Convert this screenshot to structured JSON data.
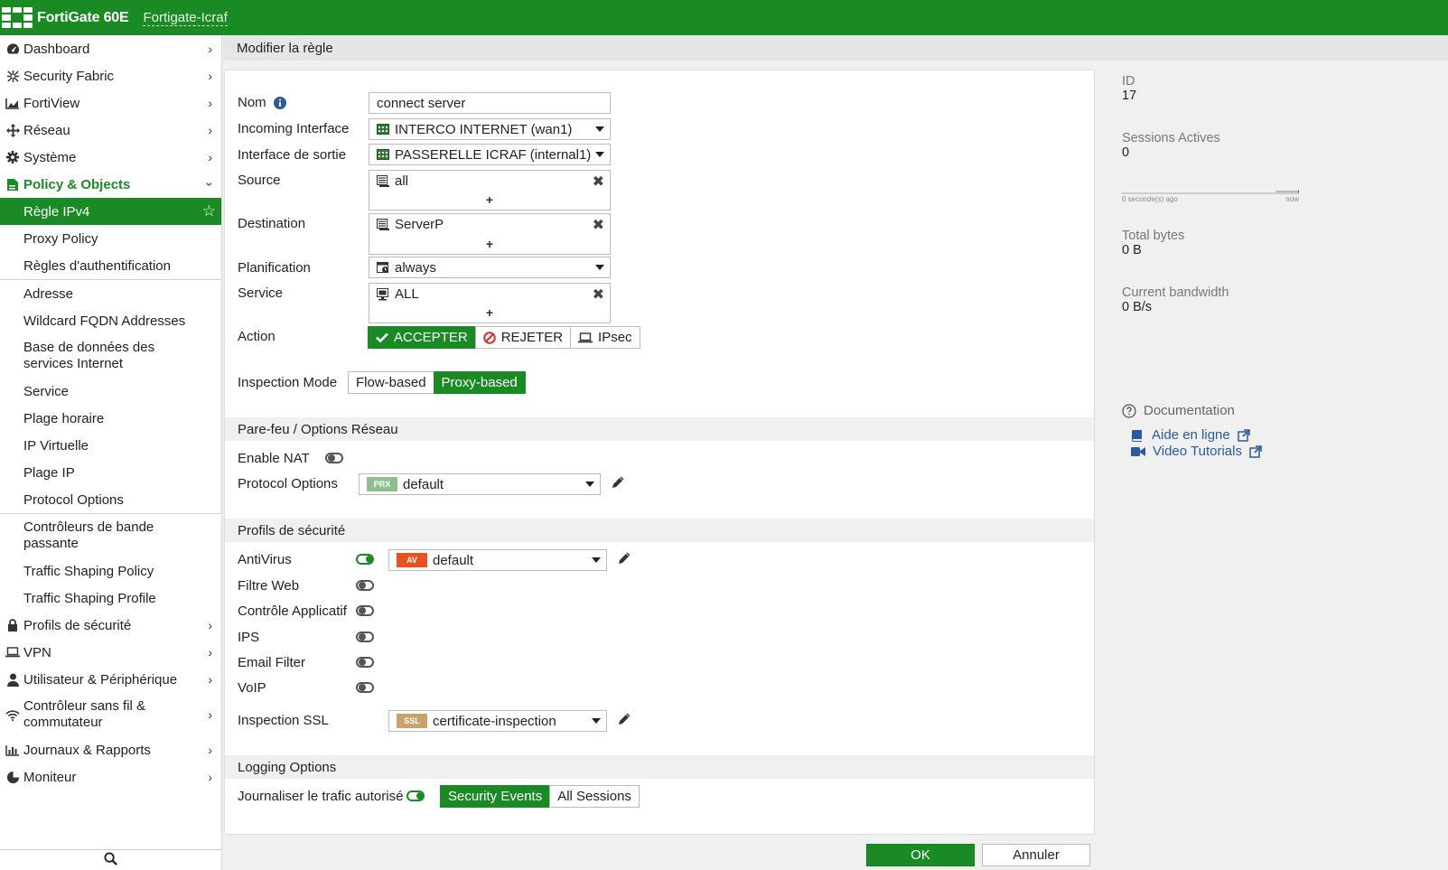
{
  "header": {
    "brand": "FortiGate 60E",
    "hostname": "Fortigate-Icraf"
  },
  "sidebar": {
    "items": [
      {
        "label": "Dashboard",
        "icon": "dashboard-icon"
      },
      {
        "label": "Security Fabric",
        "icon": "fabric-icon"
      },
      {
        "label": "FortiView",
        "icon": "chart-icon"
      },
      {
        "label": "Réseau",
        "icon": "network-icon"
      },
      {
        "label": "Système",
        "icon": "gear-icon"
      },
      {
        "label": "Policy & Objects",
        "icon": "policy-icon"
      }
    ],
    "policy_sub": [
      "Règle IPv4",
      "Proxy Policy",
      "Règles d'authentification",
      "Adresse",
      "Wildcard FQDN Addresses",
      "Base de données des services Internet",
      "Service",
      "Plage horaire",
      "IP Virtuelle",
      "Plage IP",
      "Protocol Options",
      "Contrôleurs de bande passante",
      "Traffic Shaping Policy",
      "Traffic Shaping Profile"
    ],
    "bottom_items": [
      {
        "label": "Profils de sécurité",
        "icon": "lock-icon"
      },
      {
        "label": "VPN",
        "icon": "laptop-icon"
      },
      {
        "label": "Utilisateur & Périphérique",
        "icon": "user-icon"
      },
      {
        "label": "Contrôleur sans fil & commutateur",
        "icon": "wifi-icon"
      },
      {
        "label": "Journaux & Rapports",
        "icon": "report-icon"
      },
      {
        "label": "Moniteur",
        "icon": "monitor-icon"
      }
    ]
  },
  "page": {
    "title": "Modifier la règle"
  },
  "form": {
    "name_label": "Nom",
    "name_value": "connect server",
    "incoming_label": "Incoming Interface",
    "incoming_value": "INTERCO INTERNET (wan1)",
    "outgoing_label": "Interface de sortie",
    "outgoing_value": "PASSERELLE ICRAF (internal1)",
    "source_label": "Source",
    "source_value": "all",
    "destination_label": "Destination",
    "destination_value": "ServerP",
    "schedule_label": "Planification",
    "schedule_value": "always",
    "service_label": "Service",
    "service_value": "ALL",
    "plus": "+",
    "action_label": "Action",
    "action_accept": "ACCEPTER",
    "action_deny": "REJETER",
    "action_ipsec": "IPsec",
    "inspection_label": "Inspection Mode",
    "inspection_flow": "Flow-based",
    "inspection_proxy": "Proxy-based"
  },
  "firewall_section": {
    "title": "Pare-feu / Options Réseau",
    "nat_label": "Enable NAT",
    "protocol_label": "Protocol Options",
    "protocol_badge": "PRX",
    "protocol_value": "default"
  },
  "security_section": {
    "title": "Profils de sécurité",
    "antivirus_label": "AntiVirus",
    "antivirus_badge": "AV",
    "antivirus_value": "default",
    "webfilter_label": "Filtre Web",
    "appcontrol_label": "Contrôle Applicatif",
    "ips_label": "IPS",
    "email_label": "Email Filter",
    "voip_label": "VoIP",
    "ssl_label": "Inspection SSL",
    "ssl_badge": "SSL",
    "ssl_value": "certificate-inspection"
  },
  "logging_section": {
    "title": "Logging Options",
    "log_label": "Journaliser le trafic autorisé",
    "opt_security": "Security Events",
    "opt_all": "All Sessions"
  },
  "info": {
    "id_label": "ID",
    "id_value": "17",
    "sessions_label": "Sessions Actives",
    "sessions_value": "0",
    "spark_start": "0 seconde(s) ago",
    "spark_end": "now",
    "bytes_label": "Total bytes",
    "bytes_value": "0 B",
    "bandwidth_label": "Current bandwidth",
    "bandwidth_value": "0 B/s",
    "doc_title": "Documentation",
    "doc_online": "Aide en ligne",
    "doc_video": "Video Tutorials"
  },
  "footer": {
    "ok": "OK",
    "cancel": "Annuler"
  },
  "colors": {
    "brand_green": "#1a8b24",
    "av_badge": "#e8521c",
    "prx_badge": "#8fbf8f",
    "ssl_badge": "#c8a46b",
    "link": "#2c5aa0"
  }
}
